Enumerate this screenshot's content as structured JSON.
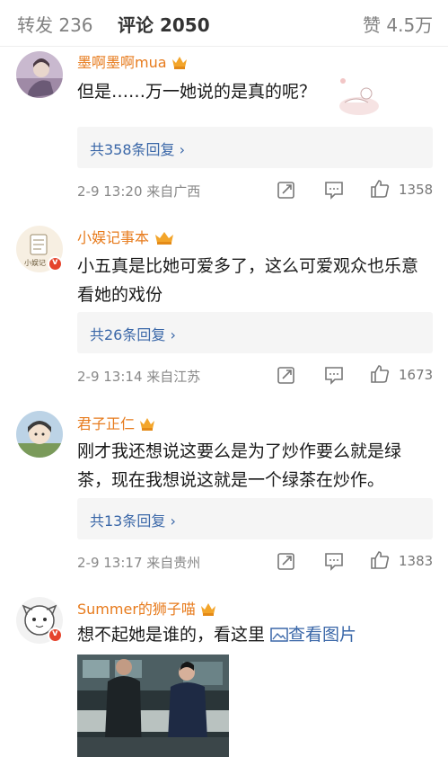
{
  "tabs": {
    "repost": "转发 236",
    "comments": "评论 2050",
    "likes": "赞 4.5万"
  },
  "comments": [
    {
      "user": "墨啊墨啊mua",
      "text": "但是……万一她说的是真的呢？",
      "replies": "共358条回复",
      "meta": "2-9 13:20  来自广西",
      "likes": "1358"
    },
    {
      "user": "小娱记事本",
      "text": "小五真是比她可爱多了，这么可爱观众也乐意看她的戏份",
      "replies": "共26条回复",
      "meta": "2-9 13:14  来自江苏",
      "likes": "1673"
    },
    {
      "user": "君子正仁",
      "text": "刚才我还想说这要么是为了炒作要么就是绿茶，现在我想说这就是一个绿茶在炒作。",
      "replies": "共13条回复",
      "meta": "2-9 13:17  来自贵州",
      "likes": "1383"
    },
    {
      "user": "Summer的狮子喵",
      "text": "想不起她是谁的，看这里 ",
      "link": "查看图片"
    }
  ],
  "icons": {
    "share": "share-icon",
    "comment": "comment-icon",
    "like": "like-icon",
    "crown": "crown-icon",
    "image_link": "image-icon"
  },
  "colors": {
    "username": "#e77b1d",
    "link": "#3a67a8",
    "reply_bg": "#f5f5f5",
    "verified": "#e5442d"
  }
}
